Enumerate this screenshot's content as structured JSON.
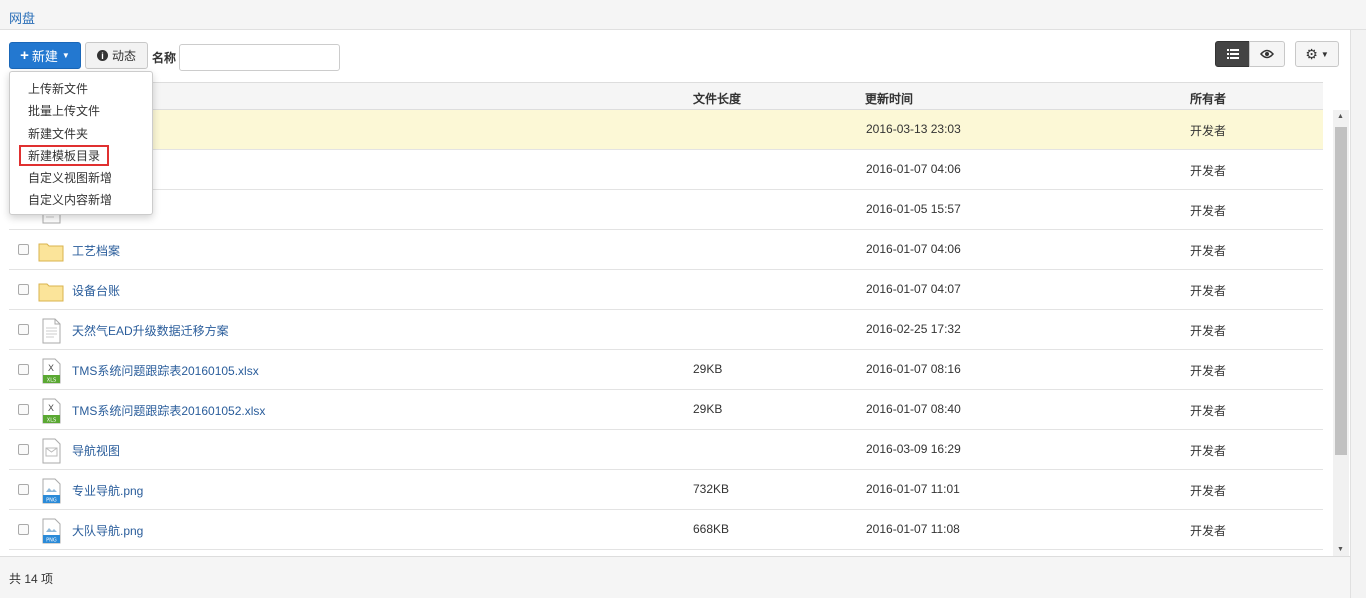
{
  "title": "网盘",
  "toolbar": {
    "new_label": "新建",
    "activity_label": "动态",
    "name_label": "名称",
    "name_value": ""
  },
  "menu": {
    "items": [
      "上传新文件",
      "批量上传文件",
      "新建文件夹",
      "新建模板目录",
      "自定义视图新增",
      "自定义内容新增"
    ],
    "highlighted": "新建模板目录"
  },
  "table": {
    "headers": {
      "size": "文件长度",
      "time": "更新时间",
      "owner": "所有者"
    },
    "rows": [
      {
        "name": "",
        "icon": "folder-icon",
        "size": "",
        "time": "2016-03-13 23:03",
        "owner": "开发者",
        "highlighted": true
      },
      {
        "name": "",
        "icon": "folder-icon",
        "size": "",
        "time": "2016-01-07 04:06",
        "owner": "开发者"
      },
      {
        "name": "",
        "icon": "document-icon",
        "size": "",
        "time": "2016-01-05 15:57",
        "owner": "开发者"
      },
      {
        "name": "工艺档案",
        "icon": "folder-icon",
        "size": "",
        "time": "2016-01-07 04:06",
        "owner": "开发者"
      },
      {
        "name": "设备台账",
        "icon": "folder-icon",
        "size": "",
        "time": "2016-01-07 04:07",
        "owner": "开发者"
      },
      {
        "name": "天然气EAD升级数据迁移方案",
        "icon": "document-icon",
        "size": "",
        "time": "2016-02-25 17:32",
        "owner": "开发者"
      },
      {
        "name": "TMS系统问题跟踪表20160105.xlsx",
        "icon": "excel-icon",
        "size": "29KB",
        "time": "2016-01-07 08:16",
        "owner": "开发者"
      },
      {
        "name": "TMS系统问题跟踪表201601052.xlsx",
        "icon": "excel-icon",
        "size": "29KB",
        "time": "2016-01-07 08:40",
        "owner": "开发者"
      },
      {
        "name": "导航视图",
        "icon": "view-icon",
        "size": "",
        "time": "2016-03-09 16:29",
        "owner": "开发者"
      },
      {
        "name": "专业导航.png",
        "icon": "png-icon",
        "size": "732KB",
        "time": "2016-01-07 11:01",
        "owner": "开发者"
      },
      {
        "name": "大队导航.png",
        "icon": "png-icon",
        "size": "668KB",
        "time": "2016-01-07 11:08",
        "owner": "开发者"
      }
    ]
  },
  "footer": {
    "count": "共 14 项"
  }
}
